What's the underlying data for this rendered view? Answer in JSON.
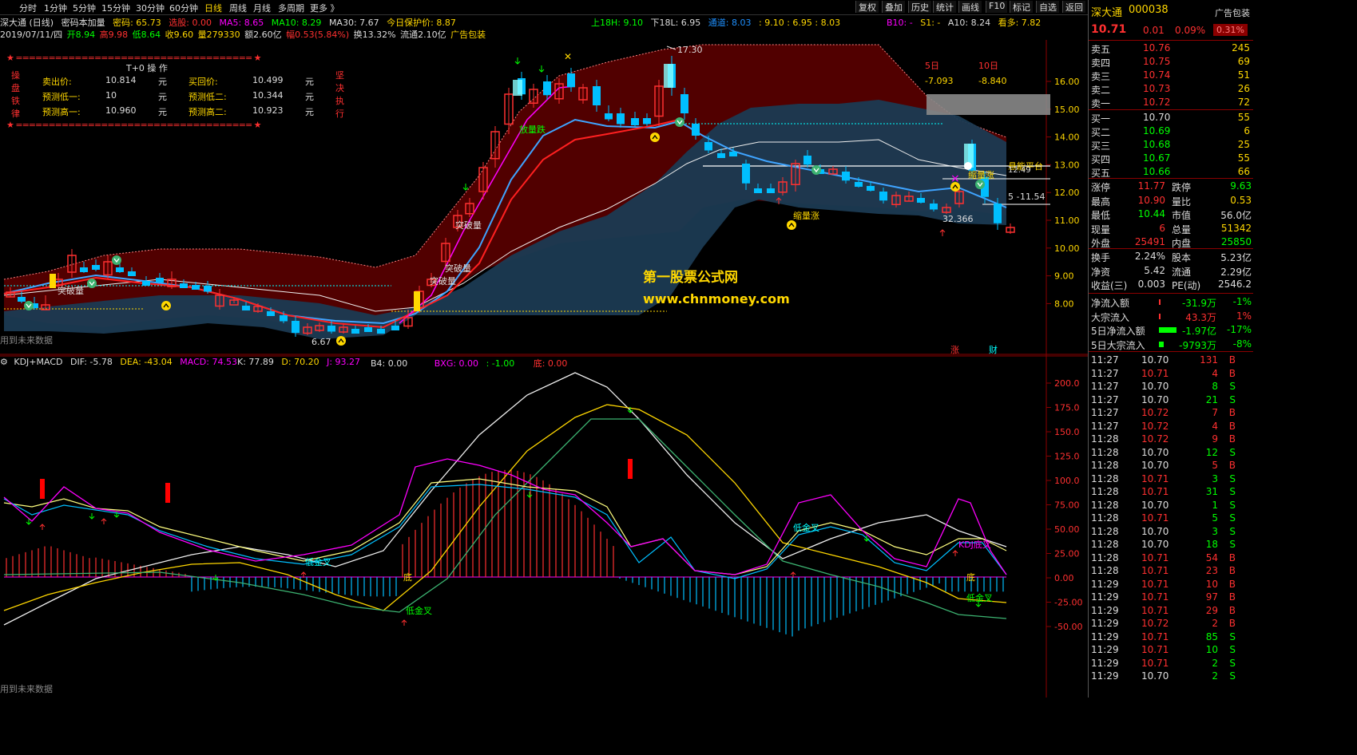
{
  "toolbar": {
    "tabs": [
      "分时",
      "1分钟",
      "5分钟",
      "15分钟",
      "30分钟",
      "60分钟",
      "日线",
      "周线",
      "月线",
      "多周期",
      "更多 》"
    ],
    "active_tab": "日线",
    "right_buttons": [
      "复权",
      "叠加",
      "历史",
      "统计",
      "画线",
      "F10",
      "标记",
      "自选",
      "返回"
    ]
  },
  "info_line1": {
    "stock": "深大通 (日线)",
    "indicator": "密码本加量",
    "mima": "密码: 65.73",
    "xuangu": "选股: 0.00",
    "ma5": "MA5: 8.65",
    "ma10": "MA10: 8.29",
    "ma30": "MA30: 7.67",
    "protect": "今日保护价: 8.87",
    "upper": "上18H: 9.10",
    "lower": "下18L: 6.95",
    "channel_label": "通道: 8.03",
    "channel_vals": ": 9.10 : 6.95 : 8.03",
    "b10": "B10: -",
    "s1": "S1: -",
    "a10": "A10: 8.24",
    "kanduo": "看多: 7.82"
  },
  "info_line2": {
    "date": "2019/07/11/四",
    "open": "开8.94",
    "high": "高9.98",
    "low": "低8.64",
    "close": "收9.60",
    "vol": "量279330",
    "amount": "额2.60亿",
    "change": "幅0.53(5.84%)",
    "turnover": "换13.32%",
    "float": "流通2.10亿",
    "ad": "广告包装"
  },
  "t0_panel": {
    "title": "T+0 操 作",
    "side_left": [
      "操",
      "盘",
      "铁",
      "律"
    ],
    "side_right": [
      "坚",
      "决",
      "执",
      "行"
    ],
    "rows": [
      {
        "l1": "卖出价:",
        "v1": "10.814",
        "u1": "元",
        "l2": "买回价:",
        "v2": "10.499",
        "u2": "元"
      },
      {
        "l1": "预测低一:",
        "v1": "10",
        "u1": "元",
        "l2": "预测低二:",
        "v2": "10.344",
        "u2": "元"
      },
      {
        "l1": "预测高一:",
        "v1": "10.960",
        "u1": "元",
        "l2": "预测高二:",
        "v2": "10.923",
        "u2": "元"
      }
    ]
  },
  "main_chart": {
    "y_ticks": [
      "16.00",
      "15.00",
      "14.00",
      "13.00",
      "12.00",
      "11.00",
      "10.00",
      "9.00",
      "8.00"
    ],
    "annotations": {
      "high_price": "17.30",
      "low_price": "6.67",
      "five_day": "5日",
      "ten_day": "10日",
      "five_day_val": "-7.093",
      "ten_day_val": "-8.840",
      "platform": "悬能平台",
      "platform_val": "12.49",
      "right_val": "11.54",
      "val_32": "32.366",
      "tufaliang": [
        "突破量",
        "突破量",
        "突破量",
        "突破量"
      ],
      "fangliangdie": "放量跌",
      "suolianzhang1": "缩量涨",
      "suolianzhang2": "缩量涨",
      "future": "用到未来数据",
      "zhang": "涨",
      "fu": "财"
    },
    "watermark_cn": "第一股票公式网",
    "watermark_url": "www.chnmoney.com"
  },
  "sub_chart": {
    "title": "KDJ+MACD",
    "dif": "DIF: -5.78",
    "dea": "DEA: -43.04",
    "macd": "MACD: 74.53",
    "k": "K: 77.89",
    "d": "D: 70.20",
    "j": "J: 93.27",
    "b4": "B4: 0.00",
    "bxg": "BXG: 0.00",
    "neg1": ": -1.00",
    "di": "底: 0.00",
    "y_ticks": [
      "200.0",
      "175.0",
      "150.0",
      "125.0",
      "100.0",
      "75.00",
      "50.00",
      "25.00",
      "0.00",
      "-25.00",
      "-50.00"
    ],
    "labels": [
      "低金叉",
      "低金叉",
      "低金叉",
      "低金叉",
      "KDJ底叉",
      "底",
      "底"
    ],
    "future": "用到未来数据"
  },
  "right_panel": {
    "name": "深大通",
    "code": "000038",
    "ad": "广告包装",
    "price": "10.71",
    "change": "0.01",
    "pct": "0.09%",
    "pct_badge": "0.31%",
    "asks": [
      {
        "label": "卖五",
        "price": "10.76",
        "vol": "245"
      },
      {
        "label": "卖四",
        "price": "10.75",
        "vol": "69"
      },
      {
        "label": "卖三",
        "price": "10.74",
        "vol": "51"
      },
      {
        "label": "卖二",
        "price": "10.73",
        "vol": "26"
      },
      {
        "label": "卖一",
        "price": "10.72",
        "vol": "72"
      }
    ],
    "bids": [
      {
        "label": "买一",
        "price": "10.70",
        "vol": "55"
      },
      {
        "label": "买二",
        "price": "10.69",
        "vol": "6"
      },
      {
        "label": "买三",
        "price": "10.68",
        "vol": "25"
      },
      {
        "label": "买四",
        "price": "10.67",
        "vol": "55"
      },
      {
        "label": "买五",
        "price": "10.66",
        "vol": "66"
      }
    ],
    "stats": [
      {
        "l1": "涨停",
        "v1": "11.77",
        "l2": "跌停",
        "v2": "9.63"
      },
      {
        "l1": "最高",
        "v1": "10.90",
        "l2": "量比",
        "v2": "0.53"
      },
      {
        "l1": "最低",
        "v1": "10.44",
        "l2": "市值",
        "v2": "56.0亿"
      },
      {
        "l1": "现量",
        "v1": "6",
        "l2": "总量",
        "v2": "51342"
      },
      {
        "l1": "外盘",
        "v1": "25491",
        "l2": "内盘",
        "v2": "25850"
      }
    ],
    "stats2": [
      {
        "l1": "换手",
        "v1": "2.24%",
        "l2": "股本",
        "v2": "5.23亿"
      },
      {
        "l1": "净资",
        "v1": "5.42",
        "l2": "流通",
        "v2": "2.29亿"
      },
      {
        "l1": "收益(三)",
        "v1": "0.003",
        "l2": "PE(动)",
        "v2": "2546.2"
      }
    ],
    "flows": [
      {
        "label": "净流入额",
        "val": "-31.9万",
        "pct": "-1%"
      },
      {
        "label": "大宗流入",
        "val": "43.3万",
        "pct": "1%"
      },
      {
        "label": "5日净流入额",
        "val": "-1.97亿",
        "pct": "-17%"
      },
      {
        "label": "5日大宗流入",
        "val": "-9793万",
        "pct": "-8%"
      }
    ],
    "ticks": [
      {
        "t": "11:27",
        "p": "10.70",
        "v": "131",
        "s": "B"
      },
      {
        "t": "11:27",
        "p": "10.71",
        "v": "4",
        "s": "B"
      },
      {
        "t": "11:27",
        "p": "10.70",
        "v": "8",
        "s": "S"
      },
      {
        "t": "11:27",
        "p": "10.70",
        "v": "21",
        "s": "S"
      },
      {
        "t": "11:27",
        "p": "10.72",
        "v": "7",
        "s": "B"
      },
      {
        "t": "11:27",
        "p": "10.72",
        "v": "4",
        "s": "B"
      },
      {
        "t": "11:28",
        "p": "10.72",
        "v": "9",
        "s": "B"
      },
      {
        "t": "11:28",
        "p": "10.70",
        "v": "12",
        "s": "S"
      },
      {
        "t": "11:28",
        "p": "10.70",
        "v": "5",
        "s": "B"
      },
      {
        "t": "11:28",
        "p": "10.71",
        "v": "3",
        "s": "S"
      },
      {
        "t": "11:28",
        "p": "10.71",
        "v": "31",
        "s": "S"
      },
      {
        "t": "11:28",
        "p": "10.70",
        "v": "1",
        "s": "S"
      },
      {
        "t": "11:28",
        "p": "10.71",
        "v": "5",
        "s": "S"
      },
      {
        "t": "11:28",
        "p": "10.70",
        "v": "3",
        "s": "S"
      },
      {
        "t": "11:28",
        "p": "10.70",
        "v": "18",
        "s": "S"
      },
      {
        "t": "11:28",
        "p": "10.71",
        "v": "54",
        "s": "B"
      },
      {
        "t": "11:28",
        "p": "10.71",
        "v": "23",
        "s": "B"
      },
      {
        "t": "11:29",
        "p": "10.71",
        "v": "10",
        "s": "B"
      },
      {
        "t": "11:29",
        "p": "10.71",
        "v": "97",
        "s": "B"
      },
      {
        "t": "11:29",
        "p": "10.71",
        "v": "29",
        "s": "B"
      },
      {
        "t": "11:29",
        "p": "10.72",
        "v": "2",
        "s": "B"
      },
      {
        "t": "11:29",
        "p": "10.71",
        "v": "85",
        "s": "S"
      },
      {
        "t": "11:29",
        "p": "10.71",
        "v": "10",
        "s": "S"
      },
      {
        "t": "11:29",
        "p": "10.71",
        "v": "2",
        "s": "S"
      },
      {
        "t": "11:29",
        "p": "10.70",
        "v": "2",
        "s": "S"
      }
    ]
  },
  "colors": {
    "up": "#ff3030",
    "down": "#00bfff",
    "yellow": "#ffd700",
    "green": "#00ff00",
    "magenta": "#ff00ff",
    "cyan": "#00ffff",
    "channel_fill": "#5a0000",
    "lower_fill": "#1b3a52"
  }
}
